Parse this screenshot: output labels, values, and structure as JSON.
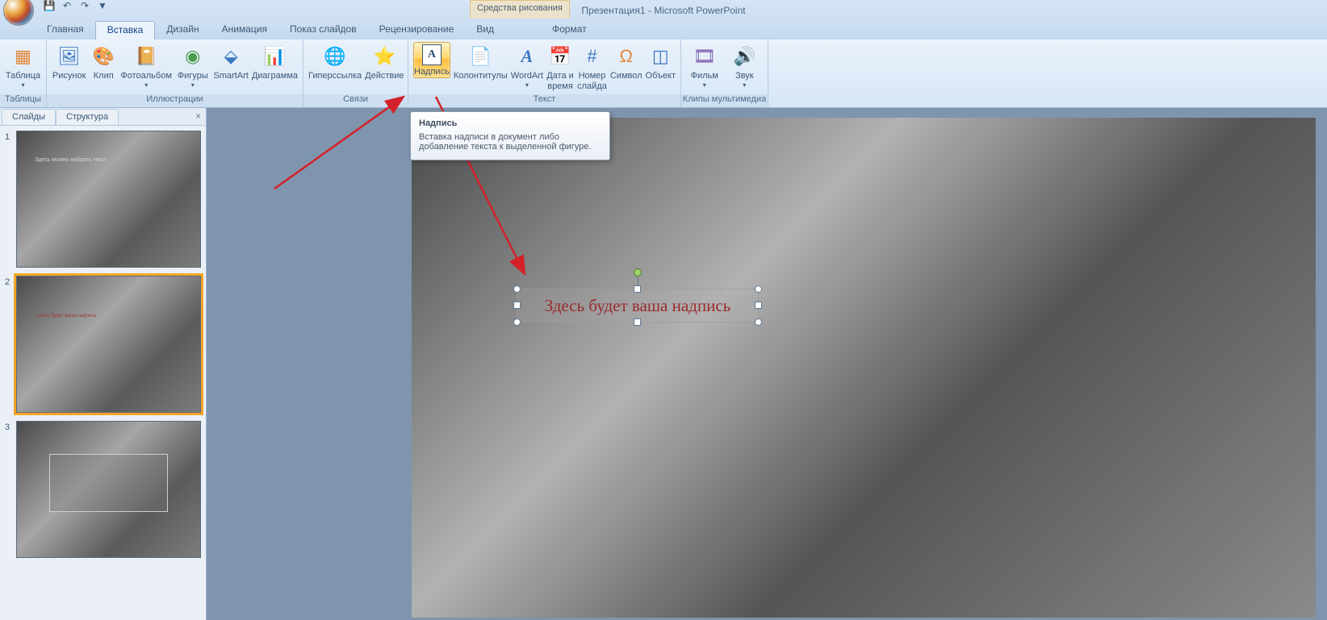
{
  "app_title": "Презентация1 - Microsoft PowerPoint",
  "contextual_tab": "Средства рисования",
  "tabs": {
    "home": "Главная",
    "insert": "Вставка",
    "design": "Дизайн",
    "anim": "Анимация",
    "show": "Показ слайдов",
    "review": "Рецензирование",
    "view": "Вид",
    "format": "Формат"
  },
  "groups": {
    "tables": "Таблицы",
    "illustrations": "Иллюстрации",
    "links": "Связи",
    "text": "Текст",
    "media": "Клипы мультимедиа"
  },
  "btn": {
    "table": "Таблица",
    "picture": "Рисунок",
    "clip": "Клип",
    "album": "Фотоальбом",
    "shapes": "Фигуры",
    "smartart": "SmartArt",
    "chart": "Диаграмма",
    "hyperlink": "Гиперссылка",
    "action": "Действие",
    "textbox": "Надпись",
    "headerfooter": "Колонтитулы",
    "wordart": "WordArt",
    "datetime": "Дата и время",
    "slidenum": "Номер слайда",
    "symbol": "Символ",
    "object": "Объект",
    "movie": "Фильм",
    "sound": "Звук"
  },
  "panel": {
    "slides": "Слайды",
    "outline": "Структура"
  },
  "thumbs": {
    "n1": "1",
    "n2": "2",
    "n3": "3",
    "t1_text": "Здесь можно набрать текст",
    "t2_text": "Здесь будет ваша надпись"
  },
  "slide_text": "Здесь будет ваша надпись",
  "tooltip": {
    "title": "Надпись",
    "body": "Вставка надписи в документ либо добавление текста к выделенной фигуре."
  }
}
